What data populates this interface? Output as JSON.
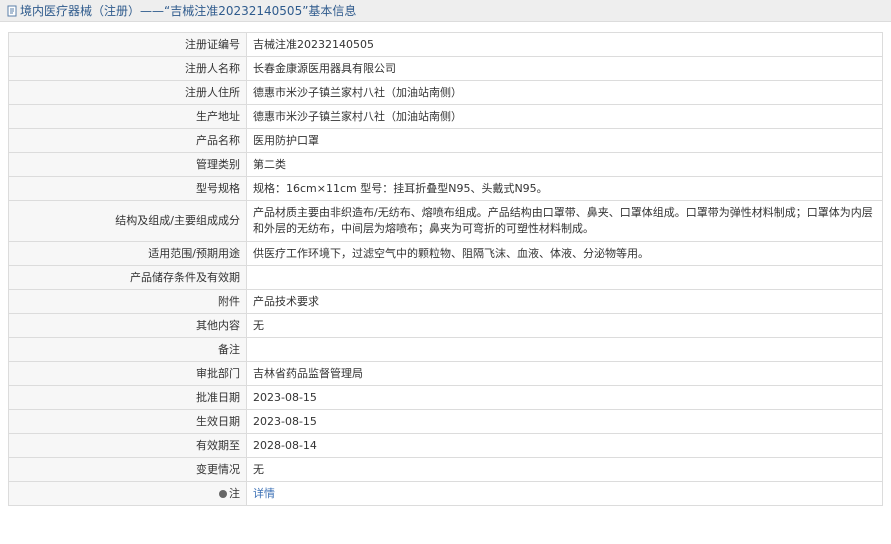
{
  "page": {
    "title": "境内医疗器械（注册）——“吉械注准20232140505”基本信息"
  },
  "rows": [
    {
      "label": "注册证编号",
      "value": "吉械注准20232140505"
    },
    {
      "label": "注册人名称",
      "value": "长春金康源医用器具有限公司"
    },
    {
      "label": "注册人住所",
      "value": "德惠市米沙子镇兰家村八社（加油站南侧）"
    },
    {
      "label": "生产地址",
      "value": "德惠市米沙子镇兰家村八社（加油站南侧）"
    },
    {
      "label": "产品名称",
      "value": "医用防护口罩"
    },
    {
      "label": "管理类别",
      "value": "第二类"
    },
    {
      "label": "型号规格",
      "value": "规格：16cm×11cm 型号：挂耳折叠型N95、头戴式N95。"
    },
    {
      "label": "结构及组成/主要组成成分",
      "value": "产品材质主要由非织造布/无纺布、熔喷布组成。产品结构由口罩带、鼻夹、口罩体组成。口罩带为弹性材料制成；口罩体为内层和外层的无纺布，中间层为熔喷布；鼻夹为可弯折的可塑性材料制成。"
    },
    {
      "label": "适用范围/预期用途",
      "value": "供医疗工作环境下，过滤空气中的颗粒物、阻隔飞沫、血液、体液、分泌物等用。"
    },
    {
      "label": "产品储存条件及有效期",
      "value": ""
    },
    {
      "label": "附件",
      "value": "产品技术要求"
    },
    {
      "label": "其他内容",
      "value": "无"
    },
    {
      "label": "备注",
      "value": ""
    },
    {
      "label": "审批部门",
      "value": "吉林省药品监督管理局"
    },
    {
      "label": "批准日期",
      "value": "2023-08-15"
    },
    {
      "label": "生效日期",
      "value": "2023-08-15"
    },
    {
      "label": "有效期至",
      "value": "2028-08-14"
    },
    {
      "label": "变更情况",
      "value": "无"
    }
  ],
  "note_row": {
    "label": "注",
    "link_text": "详情"
  },
  "colors": {
    "title_text": "#2f5b8d",
    "link": "#3a6fb5",
    "border": "#dcdcdc",
    "label_bg": "#f7f7f7"
  },
  "icons": {
    "title": "document-icon",
    "note": "pin-icon"
  }
}
